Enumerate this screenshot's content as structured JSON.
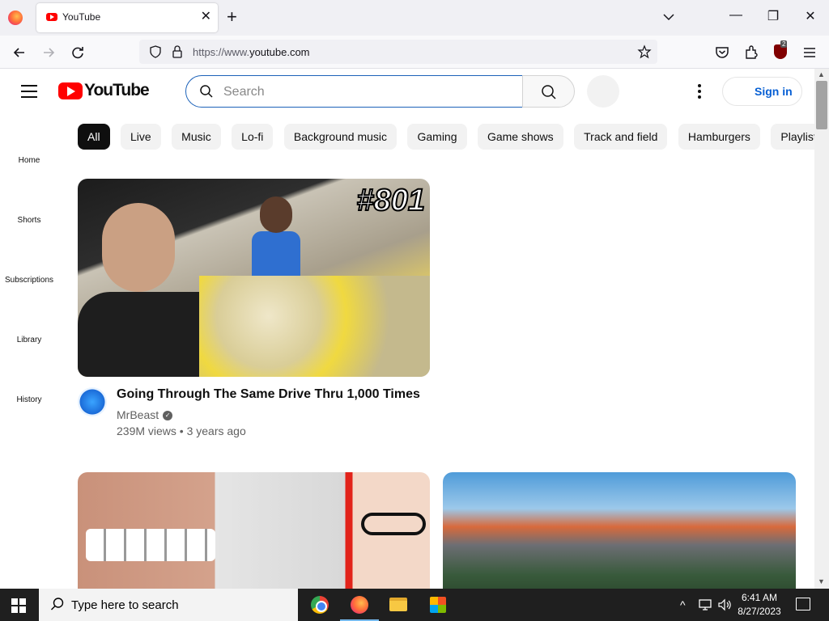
{
  "browser": {
    "tab_title": "YouTube",
    "tab_close": "✕",
    "new_tab": "+",
    "url_prefix": "https://www.",
    "url_domain": "youtube.com",
    "ublock_count": "2",
    "window_controls": {
      "minimize": "—",
      "restore": "❐",
      "close": "✕"
    }
  },
  "youtube": {
    "logo_text": "YouTube",
    "search_placeholder": "Search",
    "signin_label": "Sign in",
    "chips": [
      "All",
      "Live",
      "Music",
      "Lo-fi",
      "Background music",
      "Gaming",
      "Game shows",
      "Track and field",
      "Hamburgers",
      "Playlists"
    ],
    "sidebar": [
      "Home",
      "Shorts",
      "Subscriptions",
      "Library",
      "History"
    ],
    "video1": {
      "thumb_tag": "#801",
      "title": "Going Through The Same Drive Thru 1,000 Times",
      "channel": "MrBeast",
      "meta": "239M views • 3 years ago"
    }
  },
  "taskbar": {
    "search_text": "Type here to search",
    "time": "6:41 AM",
    "date": "8/27/2023"
  },
  "colors": {
    "yt_red": "#ff0000",
    "link_blue": "#065fd4",
    "search_focus": "#1c62b9"
  }
}
